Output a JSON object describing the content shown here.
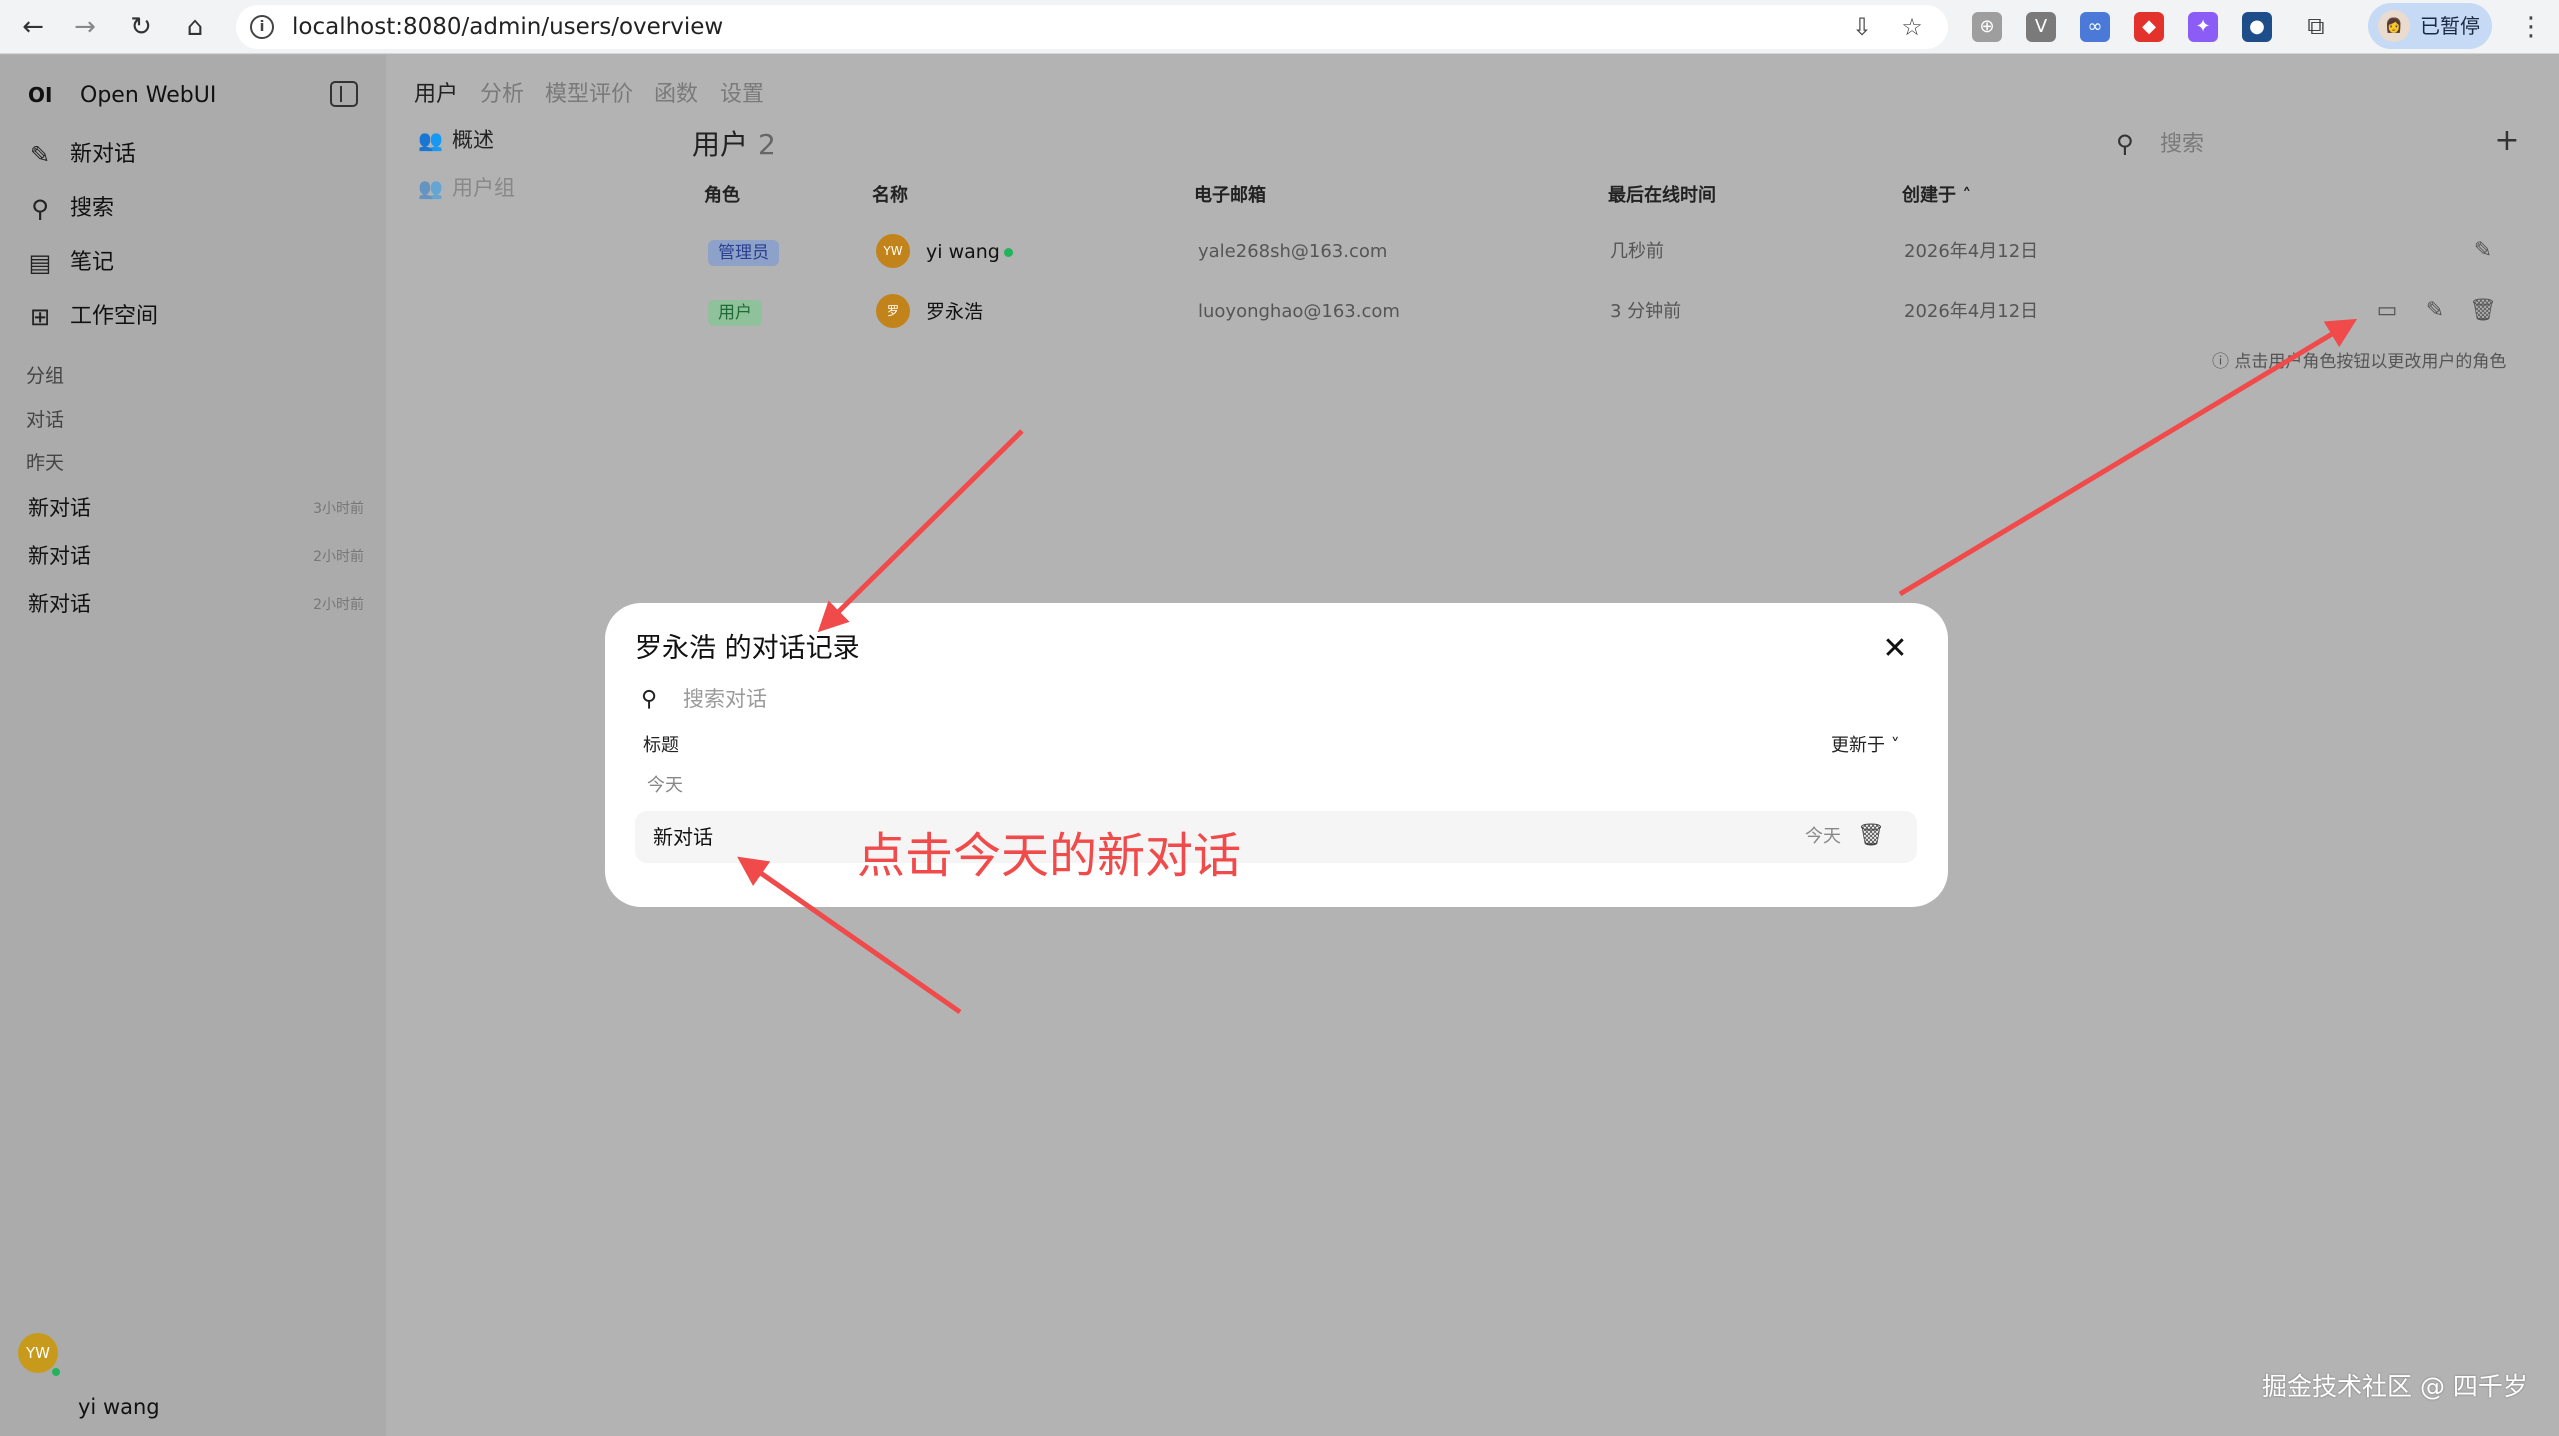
{
  "browser": {
    "url": "localhost:8080/admin/users/overview",
    "profile_label": "已暂停",
    "profile_avatar": "👩",
    "back": "←",
    "forward": "→",
    "reload": "↻",
    "home": "⌂",
    "info": "i",
    "install": "⇩",
    "star": "☆",
    "puzzle": "⧉",
    "menu": "⋮",
    "extensions": [
      {
        "name": "globe-extension-icon",
        "glyph": "⊕",
        "color": "#9e9e9e"
      },
      {
        "name": "v-extension-icon",
        "glyph": "V",
        "color": "#7a7a7a"
      },
      {
        "name": "sync-extension-icon",
        "glyph": "∞",
        "color": "#4a79d8"
      },
      {
        "name": "fox-extension-icon",
        "glyph": "◆",
        "color": "#e2322b"
      },
      {
        "name": "feather-extension-icon",
        "glyph": "✦",
        "color": "#8b5cf6"
      },
      {
        "name": "capture-extension-icon",
        "glyph": "●",
        "color": "#1d4e89"
      }
    ]
  },
  "sidebar": {
    "logo": "OI",
    "brand": "Open WebUI",
    "items": [
      {
        "icon": "✎",
        "label": "新对话"
      },
      {
        "icon": "⚲",
        "label": "搜索"
      },
      {
        "icon": "▤",
        "label": "笔记"
      },
      {
        "icon": "⊞",
        "label": "工作空间"
      }
    ],
    "sections": {
      "groups": "分组",
      "chats": "对话",
      "yesterday": "昨天"
    },
    "chats": [
      {
        "title": "新对话",
        "time": "3小时前"
      },
      {
        "title": "新对话",
        "time": "2小时前"
      },
      {
        "title": "新对话",
        "time": "2小时前"
      }
    ],
    "user": {
      "initials": "YW",
      "name": "yi wang"
    }
  },
  "main": {
    "tabs": [
      "用户",
      "分析",
      "模型评价",
      "函数",
      "设置"
    ],
    "sub_nav": [
      {
        "icon": "👥",
        "label": "概述"
      },
      {
        "icon": "👥",
        "label": "用户组"
      }
    ],
    "users_title": "用户",
    "users_count": "2",
    "search_icon": "⚲",
    "search_placeholder": "搜索",
    "add": "+",
    "columns": {
      "role": "角色",
      "name": "名称",
      "email": "电子邮箱",
      "last_active": "最后在线时间",
      "created": "创建于 ˄"
    },
    "rows": [
      {
        "role": "管理员",
        "initials": "YW",
        "name": "yi wang",
        "email": "yale268sh@163.com",
        "last_active": "几秒前",
        "created": "2026年4月12日"
      },
      {
        "role": "用户",
        "initials": "罗",
        "name": "罗永浩",
        "email": "luoyonghao@163.com",
        "last_active": "3 分钟前",
        "created": "2026年4月12日"
      }
    ],
    "row_icons": {
      "edit": "✎",
      "chat": "▭",
      "delete": "🗑"
    },
    "hint": "ⓘ 点击用户角色按钮以更改用户的角色",
    "colors": {
      "admin_badge_bg": "#8ea1c9",
      "admin_badge_fg": "#2a3f8f",
      "user_badge_bg": "#8fc19a",
      "user_badge_fg": "#1f6b33"
    }
  },
  "modal": {
    "title": "罗永浩 的对话记录",
    "close": "✕",
    "search_icon": "⚲",
    "search_placeholder": "搜索对话",
    "col_title": "标题",
    "sort_label": "更新于 ˅",
    "group": "今天",
    "chat": {
      "title": "新对话",
      "time": "今天",
      "delete": "🗑"
    }
  },
  "annotation": {
    "text": "点击今天的新对话",
    "color": "#f04a4a"
  },
  "watermark": "掘金技术社区 @ 四千岁"
}
